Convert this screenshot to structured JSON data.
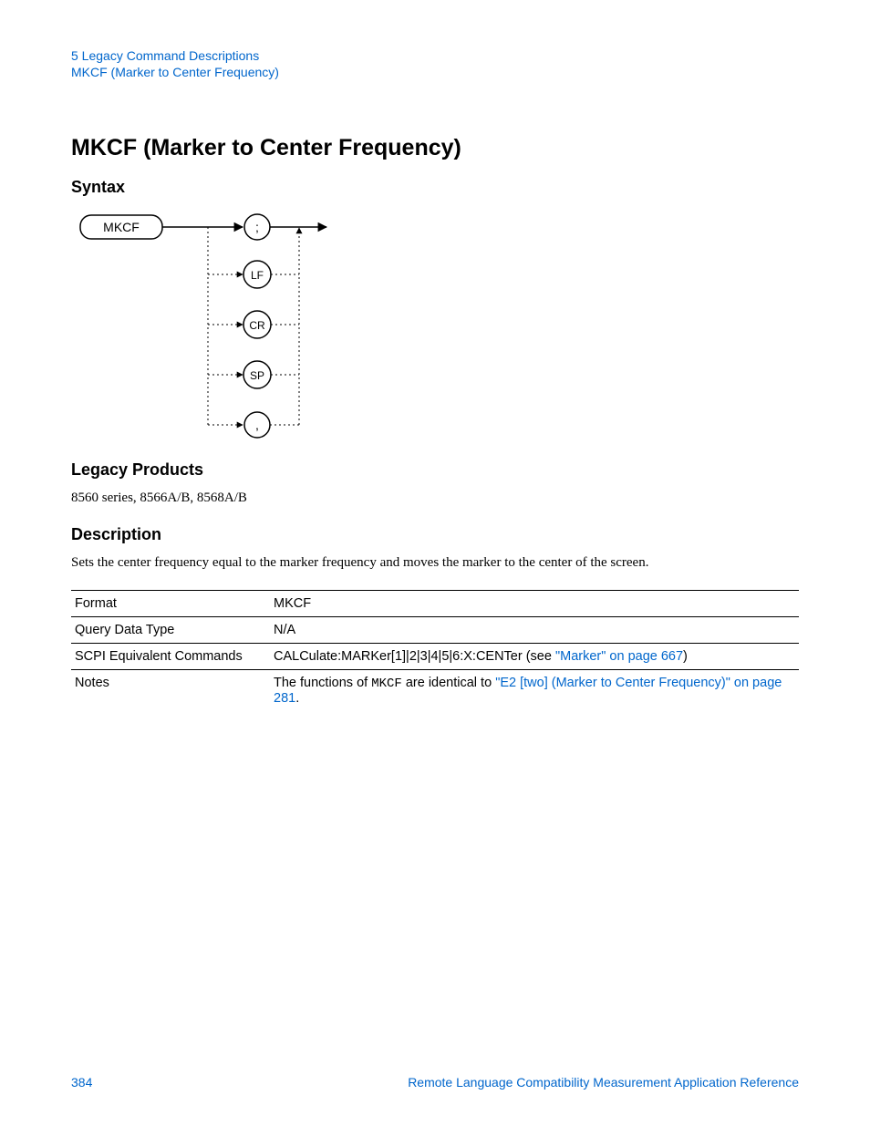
{
  "header": {
    "chapter": "5  Legacy Command Descriptions",
    "section": "MKCF (Marker to Center Frequency)"
  },
  "title": "MKCF (Marker to Center Frequency)",
  "syntax": {
    "heading": "Syntax",
    "command": "MKCF",
    "terminators": [
      ";",
      "LF",
      "CR",
      "SP",
      ","
    ]
  },
  "legacy": {
    "heading": "Legacy Products",
    "text": "8560 series, 8566A/B, 8568A/B"
  },
  "description": {
    "heading": "Description",
    "text": "Sets the center frequency equal to the marker frequency and moves the marker to the center of the screen."
  },
  "table": {
    "rows": {
      "format": {
        "label": "Format",
        "value": "MKCF"
      },
      "query": {
        "label": "Query Data Type",
        "value": "N/A"
      },
      "scpi": {
        "label": "SCPI Equivalent Commands",
        "prefix": "CALCulate:MARKer[1]|2|3|4|5|6:X:CENTer (see ",
        "link": "\"Marker\" on page 667",
        "suffix": ")"
      },
      "notes": {
        "label": "Notes",
        "prefix": "The functions of ",
        "mono": "MKCF",
        "mid": " are identical to ",
        "link": "\"E2 [two] (Marker to Center Frequency)\" on page 281",
        "suffix": "."
      }
    }
  },
  "footer": {
    "page": "384",
    "doc": "Remote Language Compatibility Measurement Application Reference"
  }
}
